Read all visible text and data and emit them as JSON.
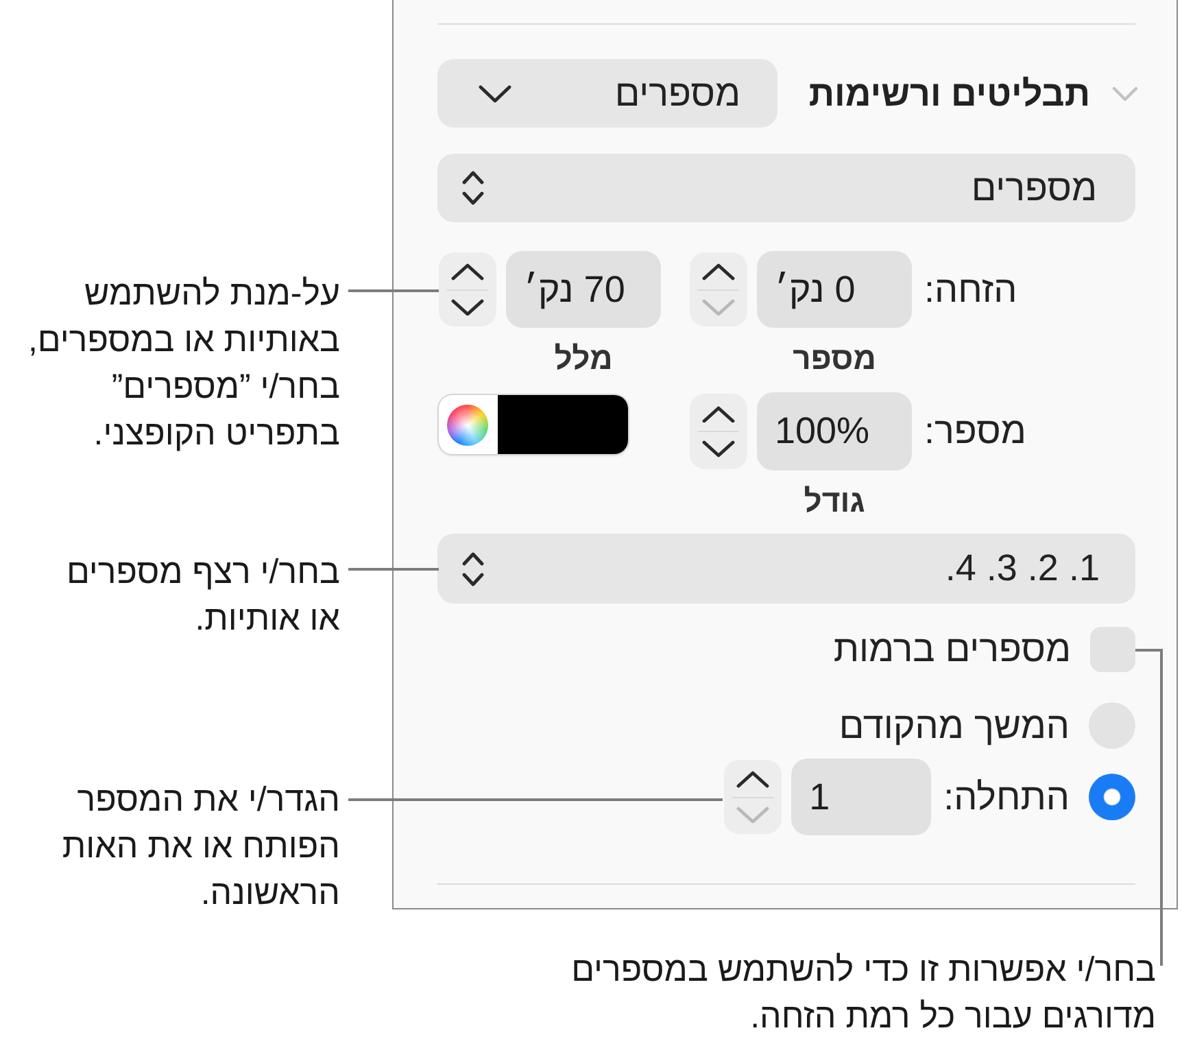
{
  "inspector": {
    "section": {
      "title": "תבליטים ורשימות",
      "expanded": true,
      "style_menu": {
        "value": "מספרים"
      }
    },
    "list_type_menu": {
      "value": "מספרים"
    },
    "indent": {
      "label": "הזחה:",
      "number": {
        "value": "0 נק׳",
        "caption": "מספר",
        "decrement_disabled": true
      },
      "text": {
        "value": "70 נק׳",
        "caption": "מלל",
        "decrement_disabled": false
      }
    },
    "number": {
      "label": "מספר:",
      "size": {
        "value": "100%",
        "caption": "גודל",
        "decrement_disabled": false
      },
      "color_well": {
        "color": "#000000"
      }
    },
    "sequence_menu": {
      "value": "1. 2. 3. 4."
    },
    "tiered_numbers": {
      "label": "מספרים ברמות",
      "checked": false
    },
    "start_options": [
      {
        "label": "המשך מהקודם",
        "selected": false
      },
      {
        "label": "התחלה:",
        "selected": true,
        "field": {
          "value": "1",
          "decrement_disabled": true
        }
      }
    ]
  },
  "callouts": [
    {
      "text": "על-מנת להשתמש\nבאותיות או במספרים,\nבחר/י ”מספרים”\nבתפריט הקופצני."
    },
    {
      "text": "בחר/י רצף מספרים\nאו אותיות."
    },
    {
      "text": "הגדר/י את המספר\nהפותח או את האות\nהראשונה."
    },
    {
      "text": "בחר/י אפשרות זו כדי להשתמש במספרים\nמדורגים עבור כל רמת הזחה."
    }
  ]
}
